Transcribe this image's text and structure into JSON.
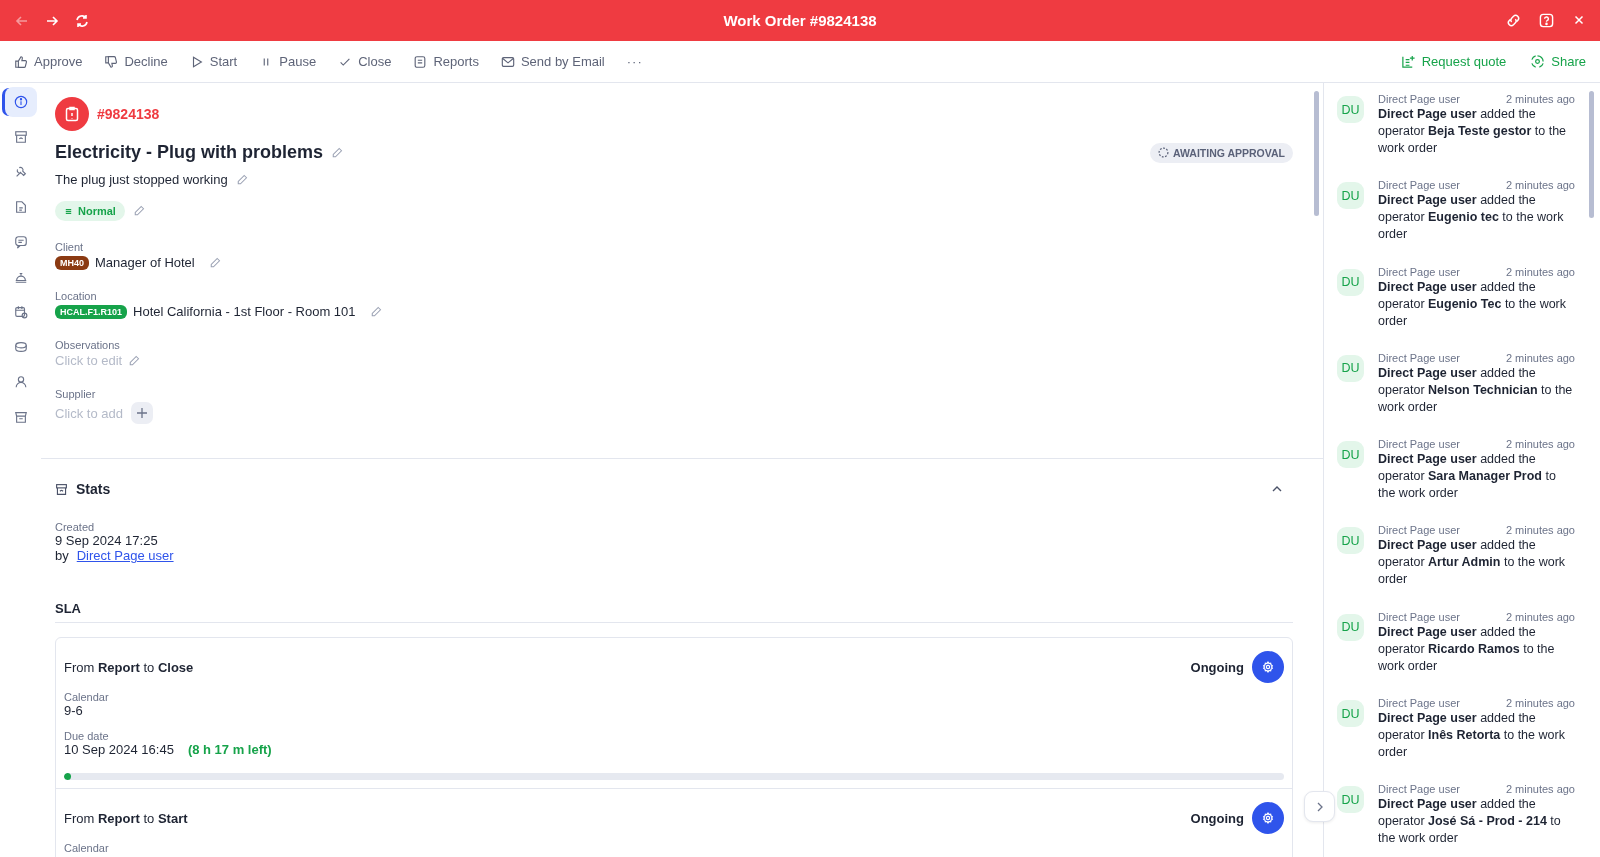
{
  "window": {
    "title": "Work Order #9824138",
    "nav": [
      {
        "kind": "back",
        "disabled": true
      },
      {
        "kind": "forward",
        "disabled": false
      },
      {
        "kind": "refresh",
        "disabled": false
      }
    ]
  },
  "toolbar": {
    "actions": [
      {
        "label": "Approve"
      },
      {
        "label": "Decline"
      },
      {
        "label": "Start"
      },
      {
        "label": "Pause"
      },
      {
        "label": "Close"
      },
      {
        "label": "Reports"
      },
      {
        "label": "Send by Email"
      }
    ],
    "more": "···",
    "right_actions": [
      {
        "label": "Request quote"
      },
      {
        "label": "Share"
      }
    ]
  },
  "sidebar": {
    "items": [
      {
        "selected": true
      },
      {
        "selected": false
      },
      {
        "selected": false
      },
      {
        "selected": false
      },
      {
        "selected": false
      },
      {
        "selected": false
      },
      {
        "selected": false
      },
      {
        "selected": false
      },
      {
        "selected": false
      },
      {
        "selected": false
      }
    ]
  },
  "work_order": {
    "number": "#9824138",
    "title": "Electricity - Plug with problems",
    "description": "The plug just stopped working",
    "status": "AWAITING APPROVAL",
    "priority": "Normal",
    "fields": [
      {
        "label": "Client",
        "kind": "tag",
        "tag": "MH40",
        "color": "#8b3a12",
        "value": "Manager of Hotel"
      },
      {
        "label": "Location",
        "kind": "tag",
        "tag": "HCAL.F1.R101",
        "color": "#16a34a",
        "value": "Hotel California - 1st Floor - Room 101"
      },
      {
        "label": "Observations",
        "kind": "edit",
        "placeholder": "Click to edit"
      },
      {
        "label": "Supplier",
        "kind": "add",
        "placeholder": "Click to add"
      }
    ]
  },
  "stats": {
    "title": "Stats",
    "expanded": true,
    "created_label": "Created",
    "created": "9 Sep 2024 17:25",
    "by_label": "by",
    "by_user": "Direct Page user"
  },
  "sla": {
    "title": "SLA",
    "items": [
      {
        "route": "From **Report** to **Close**",
        "status": "Ongoing",
        "calendar_label": "Calendar",
        "calendar": "9-6",
        "due_label": "Due date",
        "due": "10 Sep 2024 16:45",
        "left": "(8 h 17 m left)",
        "level": 0.005
      },
      {
        "route": "From **Report** to **Start**",
        "status": "Ongoing",
        "calendar_label": "Calendar"
      }
    ]
  },
  "activity": [
    {
      "avatar": "DU",
      "author": "Direct Page user",
      "time": "2 minutes ago",
      "text": "**Direct Page user** added the operator **Beja Teste gestor** to the work order"
    },
    {
      "avatar": "DU",
      "author": "Direct Page user",
      "time": "2 minutes ago",
      "text": "**Direct Page user** added the operator **Eugenio tec** to the work order"
    },
    {
      "avatar": "DU",
      "author": "Direct Page user",
      "time": "2 minutes ago",
      "text": "**Direct Page user** added the operator **Eugenio Tec** to the work order"
    },
    {
      "avatar": "DU",
      "author": "Direct Page user",
      "time": "2 minutes ago",
      "text": "**Direct Page user** added the operator **Nelson Technician** to the work order"
    },
    {
      "avatar": "DU",
      "author": "Direct Page user",
      "time": "2 minutes ago",
      "text": "**Direct Page user** added the operator **Sara Manager Prod** to the work order"
    },
    {
      "avatar": "DU",
      "author": "Direct Page user",
      "time": "2 minutes ago",
      "text": "**Direct Page user** added the operator **Artur Admin** to the work order"
    },
    {
      "avatar": "DU",
      "author": "Direct Page user",
      "time": "2 minutes ago",
      "text": "**Direct Page user** added the operator **Ricardo Ramos** to the work order"
    },
    {
      "avatar": "DU",
      "author": "Direct Page user",
      "time": "2 minutes ago",
      "text": "**Direct Page user** added the operator **Inês Retorta** to the work order"
    },
    {
      "avatar": "DU",
      "author": "Direct Page user",
      "time": "2 minutes ago",
      "text": "**Direct Page user** added the operator **José Sá - Prod - 214** to the work order"
    }
  ]
}
